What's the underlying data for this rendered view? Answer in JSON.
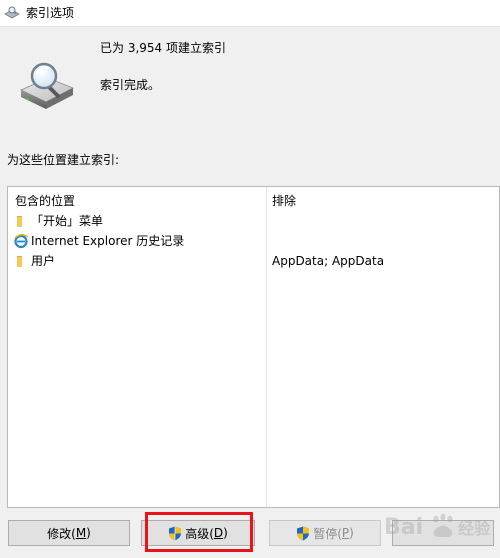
{
  "window": {
    "title": "索引选项",
    "title_icon": "indexing-options-icon"
  },
  "status": {
    "icon": "hard-drive-magnifier-icon",
    "count_text": "已为 3,954 项建立索引",
    "state_text": "索引完成。"
  },
  "locations": {
    "heading": "为这些位置建立索引:",
    "columns": {
      "included": "包含的位置",
      "excluded": "排除"
    },
    "rows": [
      {
        "icon": "folder-icon",
        "label": "「开始」菜单",
        "excluded": ""
      },
      {
        "icon": "internet-explorer-icon",
        "label": "Internet Explorer 历史记录",
        "excluded": ""
      },
      {
        "icon": "folder-icon",
        "label": "用户",
        "excluded": "AppData; AppData"
      }
    ]
  },
  "buttons": {
    "modify": {
      "label": "修改(",
      "accel": "M",
      "end": ")"
    },
    "advanced": {
      "label": "高级(",
      "accel": "D",
      "end": ")",
      "icon": "uac-shield-icon"
    },
    "pause": {
      "label": "暂停(",
      "accel": "P",
      "end": ")",
      "icon": "uac-shield-icon",
      "disabled": true
    },
    "help": {
      "label": ""
    }
  },
  "annotation": {
    "highlight_color": "#e8141a"
  },
  "colors": {
    "dialog_bg": "#f0f0f0",
    "list_bg": "#ffffff",
    "folder": "#f5c95a",
    "link": "#0b5cad"
  }
}
